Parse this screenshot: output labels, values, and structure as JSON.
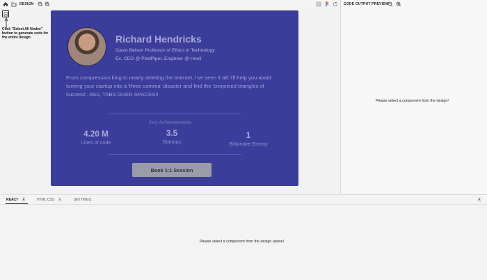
{
  "topbar": {
    "design_label": "DESIGN",
    "preview_label": "CODE OUTPUT PREVIEW"
  },
  "tooltip": {
    "text": "Click \"Select All Nodes\" button to generate code for the entire design."
  },
  "profile": {
    "name": "Richard Hendricks",
    "title": "Gavin Belson Professor of Ethics in Technology",
    "subtitle": "Ex. CEO @ PiedPiper, Engineer @ Hooli",
    "bio": "From compression king to nearly deleting the internet, I've seen it all! I'll help you avoid turning your startup into a 'three comma' disaster and find the 'conjoined triangles of success'. Also, TABS OVER SPACES!!",
    "achievements_title": "Key Achievements",
    "stats": [
      {
        "value": "4.20 M",
        "label": "Lines of code"
      },
      {
        "value": "3.5",
        "label": "Startups"
      },
      {
        "value": "1",
        "label": "Billionaire Enemy"
      }
    ],
    "book_button": "Book 1:1 Session"
  },
  "preview": {
    "message": "Please select a component from the design!"
  },
  "bottom": {
    "tabs": [
      {
        "label": "REACT"
      },
      {
        "label": "HTML CSS"
      },
      {
        "label": "SETTINGS"
      }
    ],
    "message": "Please select a component from the design above!"
  },
  "icons": {
    "home": "home-icon",
    "folder": "folder-icon",
    "zoom_out": "zoom-out-icon",
    "zoom_in": "zoom-in-icon",
    "select_all": "select-all-icon",
    "figma": "figma-icon",
    "refresh": "refresh-icon",
    "download": "download-icon"
  },
  "colors": {
    "card": "#3b3d9a",
    "accent": "#a9a9da",
    "button": "#9c9ca8"
  }
}
